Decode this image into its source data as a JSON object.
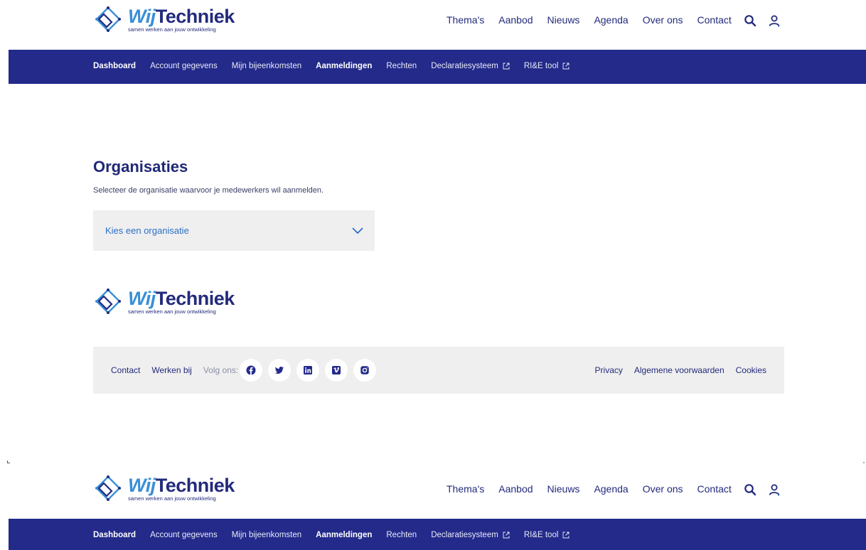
{
  "brand": {
    "wij": "Wij",
    "techniek": "Techniek",
    "tagline": "samen werken aan jouw ontwikkeling"
  },
  "topnav": {
    "items": [
      "Thema's",
      "Aanbod",
      "Nieuws",
      "Agenda",
      "Over ons",
      "Contact"
    ]
  },
  "icons": {
    "search": "search-icon",
    "user": "user-icon"
  },
  "dashnav": {
    "items": [
      {
        "label": "Dashboard",
        "bold": true
      },
      {
        "label": "Account gegevens",
        "bold": false
      },
      {
        "label": "Mijn bijeenkomsten",
        "bold": false
      },
      {
        "label": "Aanmeldingen",
        "bold": true
      },
      {
        "label": "Rechten",
        "bold": false
      },
      {
        "label": "Declaratiesysteem",
        "bold": false,
        "external": true
      },
      {
        "label": "RI&E tool",
        "bold": false,
        "external": true
      }
    ]
  },
  "main": {
    "title": "Organisaties",
    "subtitle": "Selecteer de organisatie waarvoor je medewerkers wil aanmelden.",
    "select_placeholder": "Kies een organisatie"
  },
  "footer": {
    "contact": "Contact",
    "werken_bij": "Werken bij",
    "volg_ons": "Volg ons:",
    "social": [
      "facebook-icon",
      "twitter-icon",
      "linkedin-icon",
      "vimeo-icon",
      "instagram-icon"
    ],
    "privacy": "Privacy",
    "voorwaarden": "Algemene voorwaarden",
    "cookies": "Cookies"
  },
  "colors": {
    "navy": "#232a8a",
    "accent_blue": "#3a8fd6",
    "panel_gray": "#efefef"
  }
}
